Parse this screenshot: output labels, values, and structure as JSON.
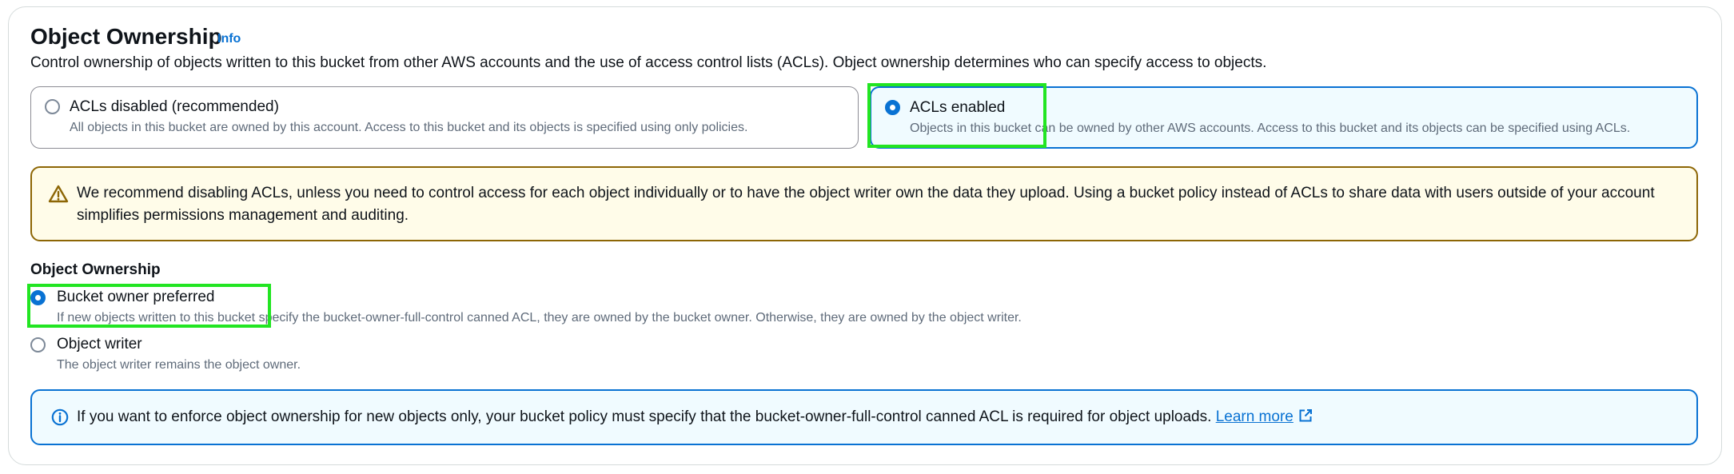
{
  "section": {
    "title": "Object Ownership",
    "info_label": "Info",
    "description": "Control ownership of objects written to this bucket from other AWS accounts and the use of access control lists (ACLs). Object ownership determines who can specify access to objects."
  },
  "acl_options": [
    {
      "label": "ACLs disabled (recommended)",
      "description": "All objects in this bucket are owned by this account. Access to this bucket and its objects is specified using only policies.",
      "selected": false
    },
    {
      "label": "ACLs enabled",
      "description": "Objects in this bucket can be owned by other AWS accounts. Access to this bucket and its objects can be specified using ACLs.",
      "selected": true
    }
  ],
  "warning": {
    "icon": "warning-triangle-icon",
    "text": "We recommend disabling ACLs, unless you need to control access for each object individually or to have the object writer own the data they upload. Using a bucket policy instead of ACLs to share data with users outside of your account simplifies permissions management and auditing."
  },
  "ownership": {
    "label": "Object Ownership",
    "options": [
      {
        "label": "Bucket owner preferred",
        "description": "If new objects written to this bucket specify the bucket-owner-full-control canned ACL, they are owned by the bucket owner. Otherwise, they are owned by the object writer.",
        "selected": true
      },
      {
        "label": "Object writer",
        "description": "The object writer remains the object owner.",
        "selected": false
      }
    ]
  },
  "info_alert": {
    "icon": "info-circle-icon",
    "text": "If you want to enforce object ownership for new objects only, your bucket policy must specify that the bucket-owner-full-control canned ACL is required for object uploads. ",
    "link_label": "Learn more",
    "link_icon": "external-link-icon"
  },
  "colors": {
    "accent": "#0972d3",
    "warning_border": "#8d6605",
    "warning_bg": "#fffce9",
    "highlight": "#22e522"
  }
}
